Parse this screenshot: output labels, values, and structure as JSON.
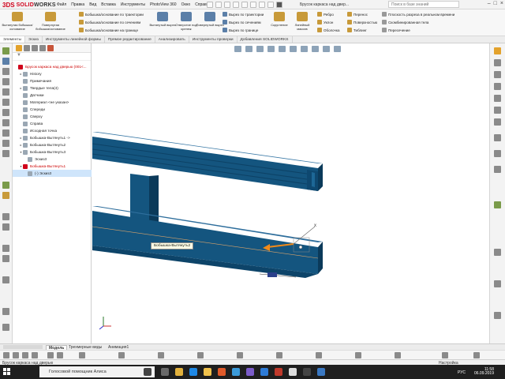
{
  "app": {
    "logo_prefix": "3DS",
    "logo_text_1": "SOLID",
    "logo_text_2": "WORKS",
    "document_title": "Брусок каркаса над двер...",
    "search_placeholder": "Поиск в базе знаний"
  },
  "menu": [
    "Файл",
    "Правка",
    "Вид",
    "Вставка",
    "Инструменты",
    "PhotoView 360",
    "Окно",
    "Справка"
  ],
  "ribbon": {
    "big_buttons": [
      {
        "label": "Вытянутая бобышка/основание"
      },
      {
        "label": "Повернутая бобышка/основание"
      },
      {
        "label": "Вытянутый вырез"
      },
      {
        "label": "Отверстие под крепеж"
      },
      {
        "label": "Повернутый вырез"
      }
    ],
    "group1": [
      "Бобышка/основание по траектории",
      "Бобышка/основание по сечениям",
      "Бобышка/основание на границе"
    ],
    "group2": [
      "Вырез по траектории",
      "Вырез по сечениям",
      "Вырез по границе"
    ],
    "group3": [
      "Скругление",
      "Линейный массив"
    ],
    "group4": [
      "Ребро",
      "Уклон",
      "Оболочка"
    ],
    "group5": [
      "Перенос",
      "Поверхностью",
      "Тиблинг"
    ],
    "group6": [
      "Плоскость разреза в реальном времени",
      "Скомбинированная тела",
      "Пересечение"
    ]
  },
  "tabs": [
    "Элементы",
    "Эскиз",
    "Инструменты линейной формы",
    "Прямое редактирование",
    "Анализировать",
    "Инструменты проверки",
    "Добавления SOLIDWORKS"
  ],
  "tree": [
    {
      "label": "Брусок каркаса над дверью (001<...",
      "indent": 0,
      "red": true,
      "arrow": ""
    },
    {
      "label": "History",
      "indent": 1,
      "arrow": "▸"
    },
    {
      "label": "Примечания",
      "indent": 1,
      "arrow": ""
    },
    {
      "label": "Твердые тела(4)",
      "indent": 1,
      "arrow": "▸"
    },
    {
      "label": "Датчики",
      "indent": 1,
      "arrow": ""
    },
    {
      "label": "Материал <не указан>",
      "indent": 1,
      "arrow": ""
    },
    {
      "label": "Спереди",
      "indent": 1,
      "arrow": ""
    },
    {
      "label": "Сверху",
      "indent": 1,
      "arrow": ""
    },
    {
      "label": "Справа",
      "indent": 1,
      "arrow": ""
    },
    {
      "label": "Исходная точка",
      "indent": 1,
      "arrow": ""
    },
    {
      "label": "Бобышка-Вытянуть1 ->",
      "indent": 1,
      "arrow": "▸"
    },
    {
      "label": "Бобышка-Вытянуть2",
      "indent": 1,
      "arrow": "▸"
    },
    {
      "label": "Бобышка-Вытянуть3",
      "indent": 1,
      "arrow": "▾"
    },
    {
      "label": "Эскиз3",
      "indent": 2,
      "arrow": ""
    },
    {
      "label": "Бобышка-Вытянуть1",
      "indent": 1,
      "arrow": "▾",
      "red": true
    },
    {
      "label": "(-) Эскиз3",
      "indent": 2,
      "arrow": "",
      "selected": true
    }
  ],
  "tooltip": "Бобышка-Вытянуть2",
  "bottom_tabs": [
    "Модель",
    "Трехмерные виды",
    "Анимация1"
  ],
  "status": {
    "left": "Брусок каркаса над дверью",
    "right": "Настройка"
  },
  "taskbar": {
    "search_text": "Голосовой помощник Алиса",
    "lang": "РУС",
    "time": "11:58",
    "date": "06.09.2019"
  },
  "colors": {
    "part_face": "#14557f",
    "part_dark": "#0b3a5a",
    "accent": "#d0021b",
    "selection": "#cfe5fb",
    "arrow": "#f08a1a"
  }
}
